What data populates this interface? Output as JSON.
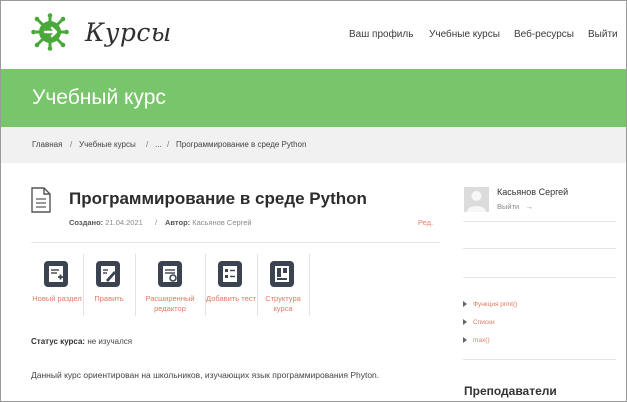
{
  "header": {
    "logo_text": "Курсы",
    "nav": [
      "Ваш профиль",
      "Учебные курсы",
      "Веб-ресурсы",
      "Выйти"
    ]
  },
  "banner": {
    "title": "Учебный курс"
  },
  "breadcrumb": [
    "Главная",
    "Учебные курсы",
    "...",
    "Программирование в среде Python"
  ],
  "page": {
    "title": "Программирование в среде Python",
    "created_label": "Создано:",
    "created_value": "21.04.2021",
    "author_label": "Автор:",
    "author_value": "Касьянов Сергей",
    "edit_link": "Ред."
  },
  "tools": [
    {
      "icon": "new-section-icon",
      "label": "Новый раздел"
    },
    {
      "icon": "edit-icon",
      "label": "Править"
    },
    {
      "icon": "advanced-editor-icon",
      "label": "Расширенный редактор"
    },
    {
      "icon": "add-test-icon",
      "label": "Добавить тест"
    },
    {
      "icon": "course-structure-icon",
      "label": "Структура курса"
    }
  ],
  "status": {
    "label": "Статус курса:",
    "value": "не изучался"
  },
  "description": "Данный курс ориентирован на  школьников, изучающих язык программирования Phyton.",
  "sidebar": {
    "user_name": "Касьянов Сергей",
    "logout": "Выйти",
    "links": [
      "Функция print()",
      "Списки",
      "max()"
    ],
    "teachers_heading": "Преподаватели"
  },
  "colors": {
    "accent_green": "#79c56b",
    "link_orange": "#e07a62"
  }
}
